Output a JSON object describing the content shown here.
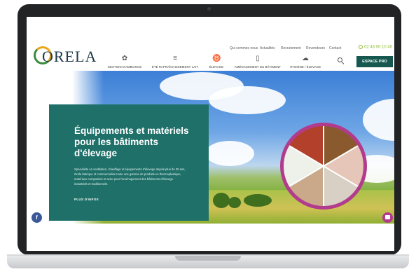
{
  "header": {
    "logo_text": "ORELA",
    "utility_links": [
      "Qui sommes nous",
      "Actualités",
      "Recrutement",
      "Revendeurs",
      "Contact"
    ],
    "phone": "02 43 00 10 40",
    "nav": [
      {
        "label": "GESTION D'AMBIANCE",
        "icon": "fan-icon"
      },
      {
        "label": "ÉTÉ RAFRAÎCHISSEMENT LAIT",
        "icon": "cooling-icon"
      },
      {
        "label": "ÉLEVAGE",
        "icon": "livestock-icon"
      },
      {
        "label": "AMÉNAGEMENT DU BÂTIMENT",
        "icon": "building-icon"
      },
      {
        "label": "HYGIÈNE / ÉLEVAGE",
        "icon": "hygiene-icon"
      }
    ],
    "pro_button": "ESPACE PRO"
  },
  "hero": {
    "title": "Équipements et matériels pour les bâtiments d'élevage",
    "description": "Spécialiste en ventilation, chauffage et équipements d'élevage depuis plus de 30 ans, Orela fabrique et commercialise toute une gamme de produits en thermoplastique, matériaux composites et acier pour l'aménagement des bâtiments d'élevage industriels et traditionnels.",
    "link": "PLUS D'INFOS"
  },
  "colors": {
    "brand_green": "#1e7069",
    "pro_button": "#16584f",
    "accent_magenta": "#b23b8d",
    "phone_green": "#8ab82a",
    "facebook": "#3b5998"
  }
}
